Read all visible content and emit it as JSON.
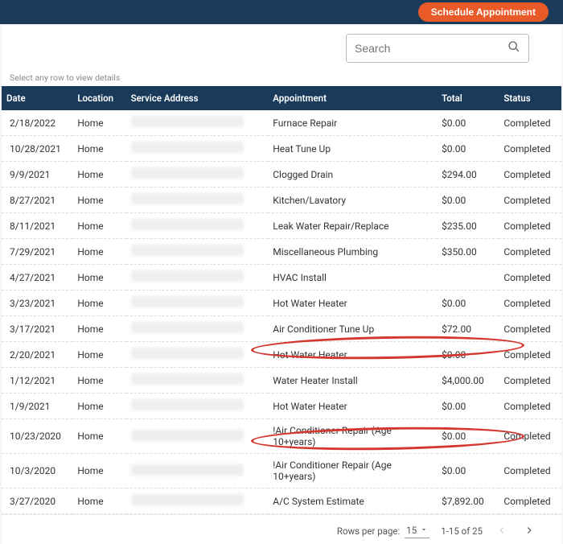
{
  "header": {
    "schedule_btn": "Schedule Appointment"
  },
  "search": {
    "placeholder": "Search"
  },
  "hint": "Select any row to view details",
  "columns": {
    "date": "Date",
    "location": "Location",
    "addr": "Service Address",
    "appt": "Appointment",
    "total": "Total",
    "status": "Status"
  },
  "rows": [
    {
      "date": "2/18/2022",
      "location": "Home",
      "appt": "Furnace Repair",
      "total": "$0.00",
      "status": "Completed"
    },
    {
      "date": "10/28/2021",
      "location": "Home",
      "appt": "Heat Tune Up",
      "total": "$0.00",
      "status": "Completed"
    },
    {
      "date": "9/9/2021",
      "location": "Home",
      "appt": "Clogged Drain",
      "total": "$294.00",
      "status": "Completed"
    },
    {
      "date": "8/27/2021",
      "location": "Home",
      "appt": "Kitchen/Lavatory",
      "total": "$0.00",
      "status": "Completed"
    },
    {
      "date": "8/11/2021",
      "location": "Home",
      "appt": "Leak Water Repair/Replace",
      "total": "$235.00",
      "status": "Completed"
    },
    {
      "date": "7/29/2021",
      "location": "Home",
      "appt": "Miscellaneous Plumbing",
      "total": "$350.00",
      "status": "Completed"
    },
    {
      "date": "4/27/2021",
      "location": "Home",
      "appt": "HVAC Install",
      "total": "",
      "status": "Completed"
    },
    {
      "date": "3/23/2021",
      "location": "Home",
      "appt": "Hot Water Heater",
      "total": "$0.00",
      "status": "Completed"
    },
    {
      "date": "3/17/2021",
      "location": "Home",
      "appt": "Air Conditioner Tune Up",
      "total": "$72.00",
      "status": "Completed"
    },
    {
      "date": "2/20/2021",
      "location": "Home",
      "appt": "Hot Water Heater",
      "total": "$0.00",
      "status": "Completed"
    },
    {
      "date": "1/12/2021",
      "location": "Home",
      "appt": "Water Heater Install",
      "total": "$4,000.00",
      "status": "Completed"
    },
    {
      "date": "1/9/2021",
      "location": "Home",
      "appt": "Hot Water Heater",
      "total": "$0.00",
      "status": "Completed"
    },
    {
      "date": "10/23/2020",
      "location": "Home",
      "appt": "!Air Conditioner Repair (Age 10+years)",
      "total": "$0.00",
      "status": "Completed"
    },
    {
      "date": "10/3/2020",
      "location": "Home",
      "appt": "!Air Conditioner Repair (Age 10+years)",
      "total": "$0.00",
      "status": "Completed"
    },
    {
      "date": "3/27/2020",
      "location": "Home",
      "appt": "A/C System Estimate",
      "total": "$7,892.00",
      "status": "Completed"
    }
  ],
  "pagination": {
    "rows_label": "Rows per page:",
    "rows_value": "15",
    "range": "1-15 of 25"
  }
}
